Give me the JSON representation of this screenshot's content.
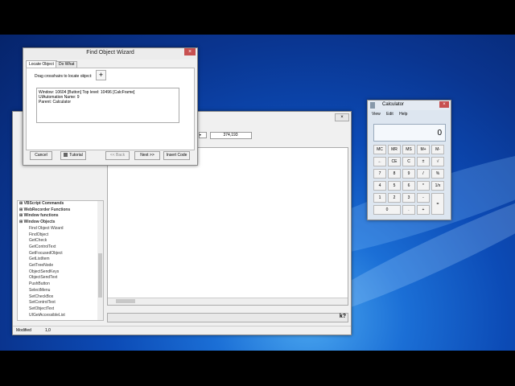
{
  "wizard": {
    "title": "Find Object Wizard",
    "close": "×",
    "tabs": [
      "Locate Object",
      "Do What"
    ],
    "instruction": "Drag crosshairs to locate object:",
    "crosshair": "+",
    "info_lines": [
      "Window: 10604 [Button] Top level: 10496 [CalcFrame]",
      "UIAutomation Name: 9",
      "Parent: Calculator"
    ],
    "buttons": {
      "cancel": "Cancel",
      "tutorial": "Tutorial",
      "back": "<< Back",
      "next": "Next >>",
      "insert": "Insert Code"
    }
  },
  "calculator": {
    "title": "Calculator",
    "menu": [
      "View",
      "Edit",
      "Help"
    ],
    "display": "0",
    "keys": [
      [
        "MC",
        "MR",
        "MS",
        "M+",
        "M-"
      ],
      [
        "←",
        "CE",
        "C",
        "±",
        "√"
      ],
      [
        "7",
        "8",
        "9",
        "/",
        "%"
      ],
      [
        "4",
        "5",
        "6",
        "*",
        "1/x"
      ],
      [
        "1",
        "2",
        "3",
        "-",
        "="
      ],
      [
        "0",
        ".",
        "+"
      ]
    ]
  },
  "editor": {
    "toolbar_value": "374,193",
    "toolbar_prefix": "k?",
    "tree": [
      {
        "label": "VBScript Commands",
        "bold": true
      },
      {
        "label": "WebRecorder Functions",
        "bold": true
      },
      {
        "label": "Window functions",
        "bold": true
      },
      {
        "label": "Window Objects",
        "bold": true
      },
      {
        "label": "Find Object Wizard",
        "bold": false
      },
      {
        "label": "FindObject",
        "bold": false
      },
      {
        "label": "GetCheck",
        "bold": false
      },
      {
        "label": "GetControlText",
        "bold": false
      },
      {
        "label": "GetFocusedObject",
        "bold": false
      },
      {
        "label": "GetListItem",
        "bold": false
      },
      {
        "label": "GetTreeNode",
        "bold": false
      },
      {
        "label": "ObjectSendKeys",
        "bold": false
      },
      {
        "label": "ObjectSendText",
        "bold": false
      },
      {
        "label": "PushButton",
        "bold": false
      },
      {
        "label": "SelectMenu",
        "bold": false
      },
      {
        "label": "SetCheckBox",
        "bold": false
      },
      {
        "label": "SetControlText",
        "bold": false
      },
      {
        "label": "SetObjectText",
        "bold": false
      },
      {
        "label": "UIGetAccessibleList",
        "bold": false
      }
    ],
    "status": {
      "left": "Modified",
      "right": "1,0"
    },
    "bottom_icon": "k?"
  }
}
